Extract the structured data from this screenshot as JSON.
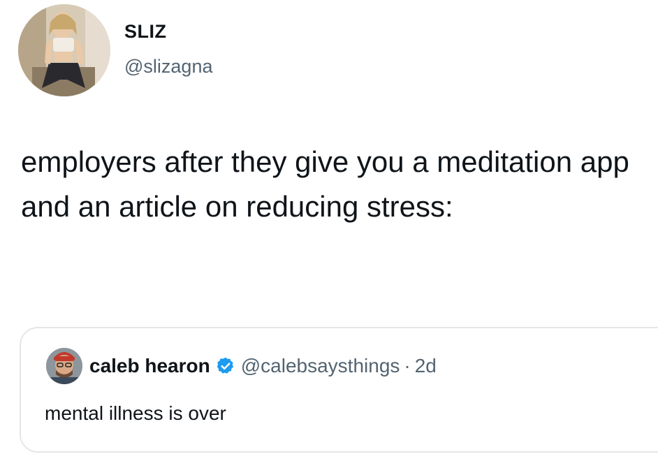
{
  "author": {
    "name": "SLIZ",
    "handle": "@slizagna",
    "avatar_icon": "profile-photo"
  },
  "tweet": {
    "text": "employers after they give you a meditation app and an article on reducing stress:"
  },
  "quoted_tweet": {
    "name": "caleb hearon",
    "verified": true,
    "verified_icon": "verified-badge-icon",
    "handle": "@calebsaysthings",
    "separator": "·",
    "time": "2d",
    "text": "mental illness is over",
    "avatar_icon": "profile-photo"
  },
  "colors": {
    "text_primary": "#0f1419",
    "text_secondary": "#536471",
    "verified_blue": "#1d9bf0",
    "card_border": "#e3e6e9"
  }
}
